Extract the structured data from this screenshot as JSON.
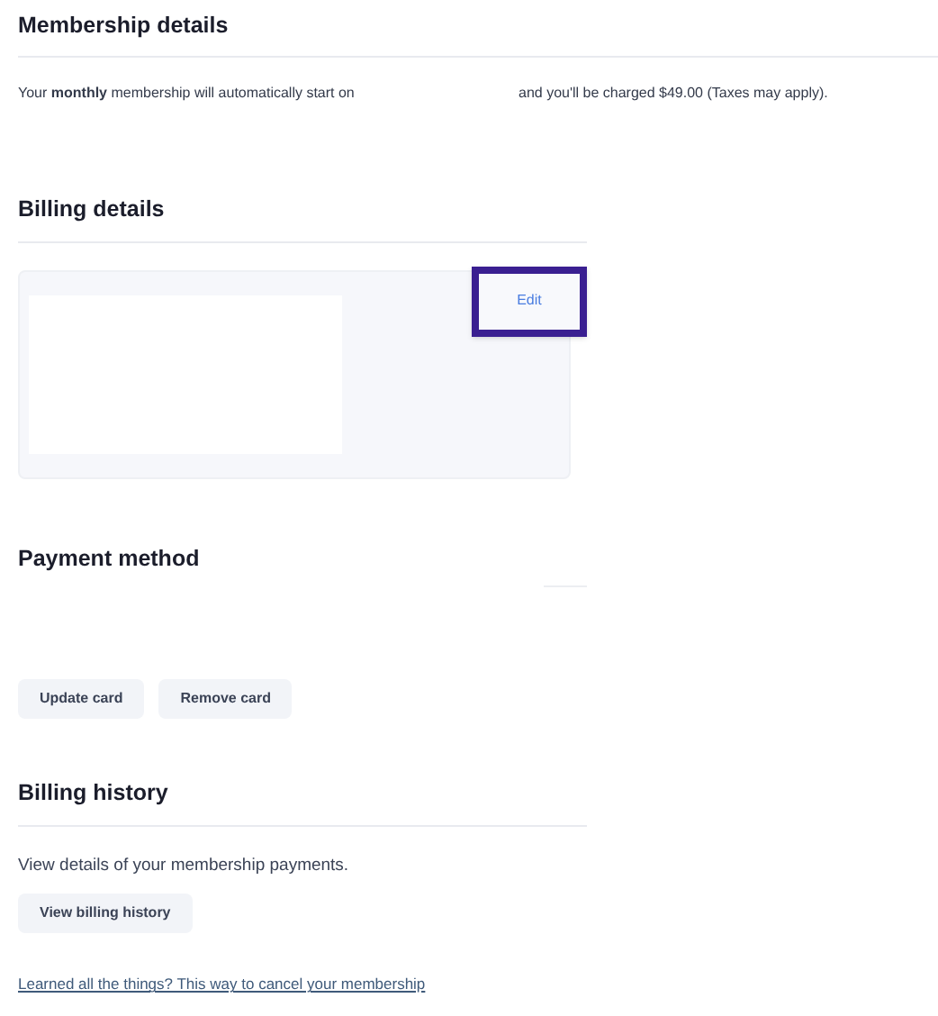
{
  "membership": {
    "title": "Membership details",
    "text_before": "Your **monthly** membership will automatically start on",
    "text_after": "and you'll be charged $49.00 (Taxes may apply)."
  },
  "billing_details": {
    "title": "Billing details",
    "edit_button": {
      "label": "Edit",
      "highlighted": true
    }
  },
  "payment_method": {
    "title": "Payment method",
    "buttons": [
      "Update card",
      "Remove card"
    ]
  },
  "billing_history": {
    "title": "Billing history",
    "description": "View details of your membership payments.",
    "button": "View billing history"
  },
  "cancel_link": "Learned all the things? This way to cancel your membership"
}
